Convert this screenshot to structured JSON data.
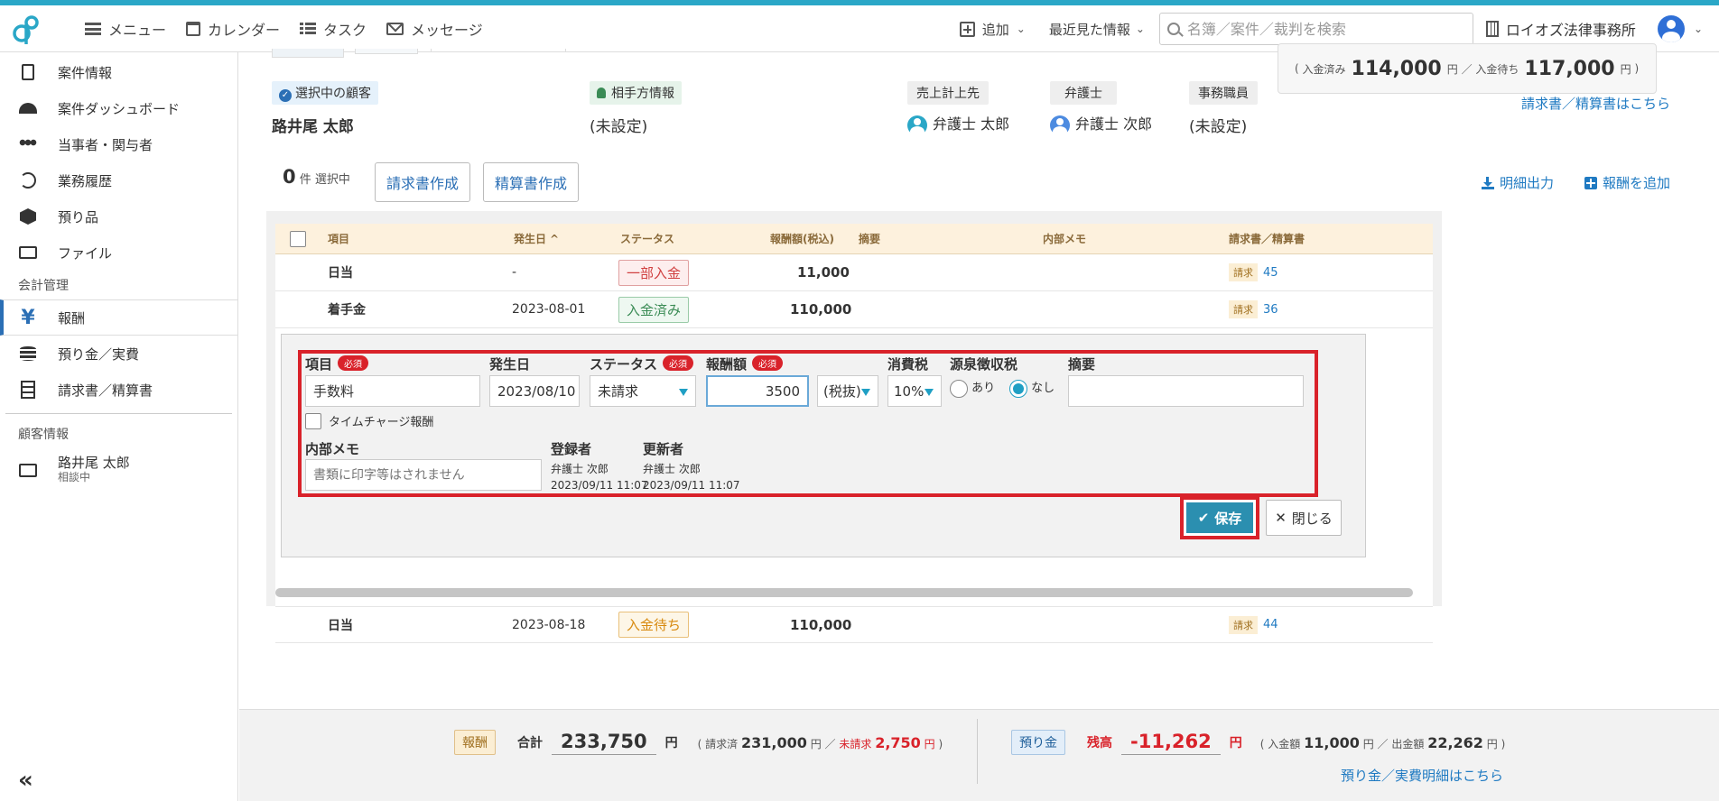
{
  "nav": {
    "menu": "メニュー",
    "calendar": "カレンダー",
    "task": "タスク",
    "message": "メッセージ",
    "add": "追加",
    "recent": "最近見た情報",
    "search_placeholder": "名簿／案件／裁判を検索",
    "office": "ロイオズ法律事務所"
  },
  "sidebar": {
    "items": [
      {
        "label": "案件情報",
        "icon": "document-icon"
      },
      {
        "label": "案件ダッシュボード",
        "icon": "gauge-icon"
      },
      {
        "label": "当事者・関与者",
        "icon": "people-icon"
      },
      {
        "label": "業務履歴",
        "icon": "history-icon"
      },
      {
        "label": "預り品",
        "icon": "box-icon"
      },
      {
        "label": "ファイル",
        "icon": "folder-icon"
      }
    ],
    "section_accounting": "会計管理",
    "active_item": {
      "label": "報酬",
      "icon": "yen-icon",
      "glyph": "¥"
    },
    "accounting_items": [
      {
        "label": "預り金／実費",
        "icon": "coins-icon"
      },
      {
        "label": "請求書／精算書",
        "icon": "invoice-icon"
      }
    ],
    "section_client": "顧客情報",
    "client": {
      "name": "路井尾 太郎",
      "status": "相談中"
    },
    "collapse": "«"
  },
  "summary": {
    "paid_label": "入金済み",
    "paid_amount": "114,000",
    "pending_label": "入金待ち",
    "pending_amount": "117,000",
    "yen": "円",
    "invoice_link": "請求書／精算書はこちら"
  },
  "customer": {
    "selected_label": "選択中の顧客",
    "selected_name": "路井尾 太郎",
    "opponent_label": "相手方情報",
    "opponent_value": "(未設定)",
    "sales_label": "売上計上先",
    "sales_value": "弁護士 太郎",
    "lawyer_label": "弁護士",
    "lawyer_value": "弁護士 次郎",
    "staff_label": "事務職員",
    "staff_value": "(未設定)"
  },
  "toolbar": {
    "selected_count": "0",
    "selected_suffix": "件 選択中",
    "invoice_btn": "請求書作成",
    "settlement_btn": "精算書作成",
    "export": "明細出力",
    "add_fee": "報酬を追加"
  },
  "table": {
    "headers": {
      "item": "項目",
      "date": "発生日",
      "status": "ステータス",
      "amount": "報酬額(税込)",
      "summary": "摘要",
      "memo": "内部メモ",
      "invoice": "請求書／精算書"
    },
    "rows": [
      {
        "item": "日当",
        "date": "-",
        "status": "一部入金",
        "amount": "11,000",
        "invoice_tag": "請求",
        "invoice_no": "45"
      },
      {
        "item": "着手金",
        "date": "2023-08-01",
        "status": "入金済み",
        "amount": "110,000",
        "invoice_tag": "請求",
        "invoice_no": "36"
      },
      {
        "item": "日当",
        "date": "2023-08-18",
        "status": "入金待ち",
        "amount": "110,000",
        "invoice_tag": "請求",
        "invoice_no": "44"
      }
    ]
  },
  "form": {
    "item_label": "項目",
    "required": "必須",
    "item_value": "手数料",
    "date_label": "発生日",
    "date_value": "2023/08/10",
    "status_label": "ステータス",
    "status_value": "未請求",
    "amount_label": "報酬額",
    "amount_value": "3500",
    "tax_mode": "(税抜)",
    "tax_label": "消費税",
    "tax_rate": "10%",
    "withholding_label": "源泉徴収税",
    "withholding_yes": "あり",
    "withholding_no": "なし",
    "summary_label": "摘要",
    "timecharge_label": "タイムチャージ報酬",
    "memo_label": "内部メモ",
    "memo_placeholder": "書類に印字等はされません",
    "creator_label": "登録者",
    "creator_name": "弁護士 次郎",
    "creator_time": "2023/09/11 11:07",
    "updater_label": "更新者",
    "updater_name": "弁護士 次郎",
    "updater_time": "2023/09/11 11:07",
    "save": "保存",
    "close": "閉じる"
  },
  "footer": {
    "fee_tag": "報酬",
    "total_label": "合計",
    "total_amount": "233,750",
    "yen": "円",
    "billed_label": "請求済",
    "billed_amount": "231,000",
    "unbilled_label": "未請求",
    "unbilled_amount": "2,750",
    "deposit_tag": "預り金",
    "balance_label": "残高",
    "balance_amount": "-11,262",
    "deposit_in_label": "入金額",
    "deposit_in_amount": "11,000",
    "withdraw_label": "出金額",
    "withdraw_amount": "22,262",
    "deposit_link": "預り金／実費明細はこちら"
  },
  "colors": {
    "accent": "#2aa7c7",
    "required": "#d9222a",
    "link": "#1f7ac2"
  }
}
